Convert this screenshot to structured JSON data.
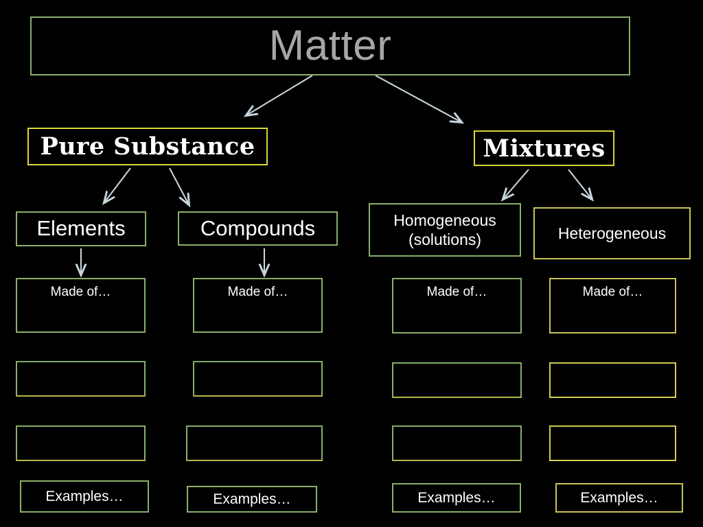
{
  "slide": {
    "background_color": "#000000",
    "title": {
      "text": "Matter",
      "color": "#a6a6a6",
      "border_color": "#8ab06a"
    },
    "level2": [
      {
        "label": "Pure Substance",
        "border_color": "#d8d838"
      },
      {
        "label": "Mixtures",
        "border_color": "#d8d838"
      }
    ],
    "level3": [
      {
        "label": "Elements",
        "border_color": "#8ab06a"
      },
      {
        "label": "Compounds",
        "border_color": "#8ab06a"
      },
      {
        "label": "Homogeneous\n(solutions)",
        "line1": "Homogeneous",
        "line2": "(solutions)",
        "border_color": "#8ab06a"
      },
      {
        "label": "Heterogeneous",
        "border_color": "#c9c356"
      }
    ],
    "made_of_row": [
      {
        "label": "Made of…",
        "border_color": "#8ab06a"
      },
      {
        "label": "Made of…",
        "border_color": "#8ab06a"
      },
      {
        "label": "Made of…",
        "border_color": "#8ab06a"
      },
      {
        "label": "Made of…",
        "border_color": "#c9c356"
      }
    ],
    "blank_row_1": [
      {
        "label": "",
        "border_color": "#8ab06a"
      },
      {
        "label": "",
        "border_color": "#8ab06a"
      },
      {
        "label": "",
        "border_color": "#8ab06a"
      },
      {
        "label": "",
        "border_color": "#d4cd4e"
      }
    ],
    "blank_row_2": [
      {
        "label": "",
        "border_color": "#8ab06a"
      },
      {
        "label": "",
        "border_color": "#8ab06a"
      },
      {
        "label": "",
        "border_color": "#8ab06a"
      },
      {
        "label": "",
        "border_color": "#d4cd4e"
      }
    ],
    "examples_row": [
      {
        "label": "Examples…",
        "border_color": "#8ab06a"
      },
      {
        "label": "Examples…",
        "border_color": "#8ab06a"
      },
      {
        "label": "Examples…",
        "border_color": "#8ab06a"
      },
      {
        "label": "Examples…",
        "border_color": "#c9c356"
      }
    ],
    "connectors": {
      "color": "#c7d6dd",
      "count": 6,
      "description": "arrows from Matter to the two branches, from each branch to its two subtypes, and from Elements and Compounds down to their Made of boxes"
    }
  }
}
